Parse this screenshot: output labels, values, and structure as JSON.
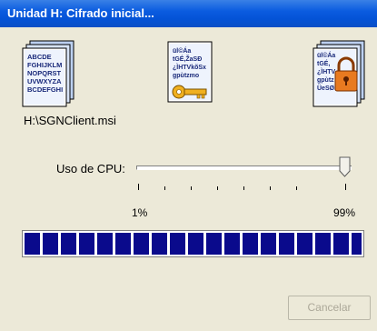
{
  "window": {
    "title": "Unidad H: Cifrado inicial..."
  },
  "icons": {
    "plain": {
      "name": "plain-document-stack-icon",
      "lines": [
        "ABCDE",
        "FGHIJKLM",
        "NOPQRST",
        "UVWXYZA",
        "BCDEFGHI"
      ]
    },
    "encrypting": {
      "name": "encrypting-document-key-icon",
      "lines": [
        "ül©Áa",
        "tGÉ,ŽaSÐ",
        "¿ÌHTVkõSx",
        "gpùtzmo"
      ]
    },
    "encrypted": {
      "name": "encrypted-document-lock-icon",
      "lines": [
        "ül©Áa",
        "tGÉ,",
        "¿ÌHTV",
        "gpùtz",
        "ÜeSØP,hž"
      ]
    }
  },
  "file": {
    "path": "H:\\SGNClient.msi"
  },
  "cpu": {
    "label": "Uso de CPU:",
    "min_label": "1%",
    "max_label": "99%",
    "value_percent": 99
  },
  "progress": {
    "fraction": 1.0,
    "color": "#0a0a8c"
  },
  "buttons": {
    "cancel": "Cancelar"
  }
}
